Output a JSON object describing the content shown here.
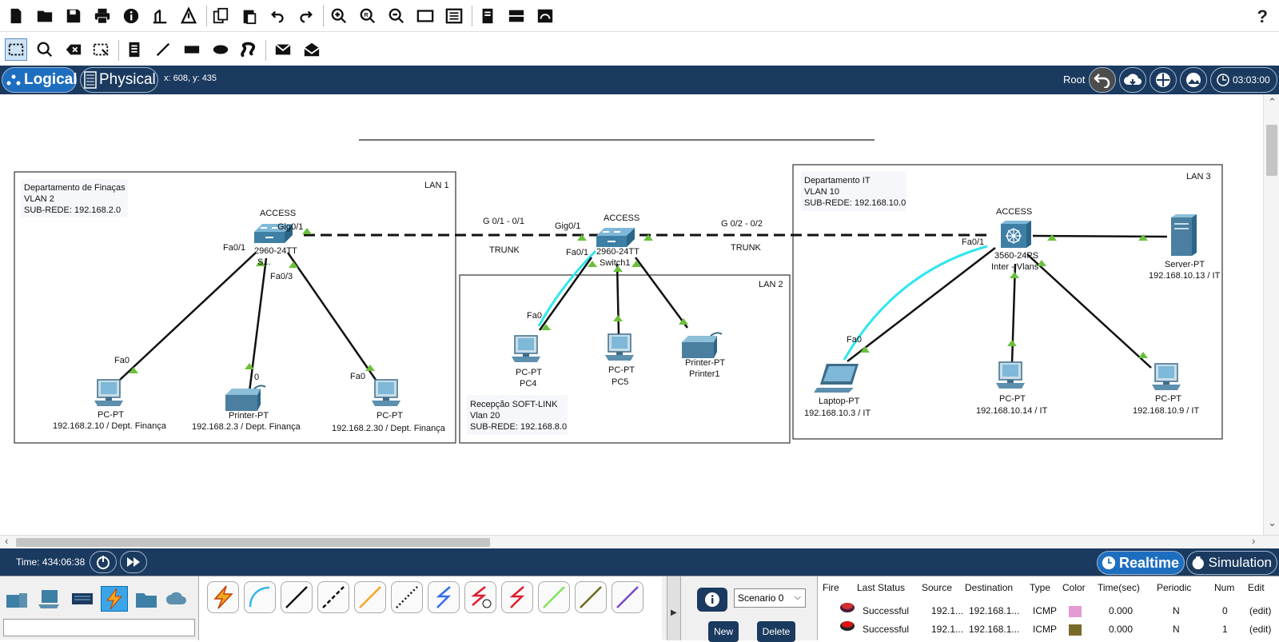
{
  "top_toolbar": {
    "icons": [
      "new-file-icon",
      "open-folder-icon",
      "save-icon",
      "print-icon",
      "info-icon",
      "activity-wizard-icon",
      "custom-pdu-icon",
      "copy-icon",
      "paste-icon",
      "undo-icon",
      "redo-icon",
      "zoom-in-icon",
      "zoom-reset-icon",
      "zoom-out-icon",
      "drawing-palette-icon",
      "custom-devices-icon",
      "notes-icon",
      "cluster-icon",
      "viewport-icon"
    ],
    "help": "?"
  },
  "edit_toolbar": {
    "icons": [
      "select-icon",
      "inspect-icon",
      "delete-icon",
      "resize-icon",
      "note-icon",
      "line-icon",
      "rectangle-icon",
      "ellipse-icon",
      "freeform-icon",
      "simple-pdu-icon",
      "complex-pdu-icon"
    ]
  },
  "navbar": {
    "logical_label": "Logical",
    "physical_label": "Physical",
    "coords": "x: 608, y: 435",
    "root_label": "Root",
    "clock": "03:03:00"
  },
  "topology": {
    "zones": {
      "lan1": {
        "tag": "LAN 1",
        "desc": [
          "Departamento de Finaças",
          "VLAN 2",
          "SUB-REDE: 192.168.2.0"
        ]
      },
      "lan2": {
        "tag": "LAN 2",
        "desc": [
          "Recepção SOFT-LINK",
          "Vlan 20",
          "SUB-REDE: 192.168.8.0"
        ]
      },
      "lan3": {
        "tag": "LAN 3",
        "desc": [
          "Departamento IT",
          "VLAN 10",
          "SUB-REDE: 192.168.10.0"
        ]
      }
    },
    "switch_left": {
      "role": "ACCESS",
      "model": "2960-24TT",
      "name": "S..."
    },
    "switch_mid": {
      "role": "ACCESS",
      "model": "2960-24TT",
      "name": "Switch1"
    },
    "switch_right": {
      "role": "ACCESS",
      "model": "3560-24PS",
      "name": "Inter - Vlans"
    },
    "trunk_left": {
      "ports": "G 0/1 - 0/1",
      "type": "TRUNK"
    },
    "trunk_right": {
      "ports": "G 0/2 - 0/2",
      "type": "TRUNK"
    },
    "ports": {
      "gig01_left": "Gig0/1",
      "gig01_mid": "Gig0/1",
      "fa01_left": "Fa0/1",
      "fa03_left": "Fa0/3",
      "fa01_mid": "Fa0/1",
      "fa01_right": "Fa0/1",
      "fa0_pc1": "Fa0",
      "p0_printer": "0",
      "fa0_pc2": "Fa0",
      "fa0_pc4": "Fa0",
      "fa0_laptop": "Fa0"
    },
    "devices": {
      "pc_a": {
        "type": "PC-PT",
        "label": "192.168.2.10 / Dept. Finança"
      },
      "printer_a": {
        "type": "Printer-PT",
        "label": "192.168.2.3 / Dept. Finança"
      },
      "pc_b": {
        "type": "PC-PT",
        "label": "192.168.2.30 / Dept. Finança"
      },
      "pc4": {
        "type": "PC-PT",
        "label": "PC4"
      },
      "pc5": {
        "type": "PC-PT",
        "label": "PC5"
      },
      "printer1": {
        "type": "Printer-PT",
        "label": "Printer1"
      },
      "laptop": {
        "type": "Laptop-PT",
        "label": "192.168.10.3 / IT"
      },
      "pc_it14": {
        "type": "PC-PT",
        "label": "192.168.10.14 / IT"
      },
      "pc_it9": {
        "type": "PC-PT",
        "label": "192.168.10.9 / IT"
      },
      "server": {
        "type": "Server-PT",
        "label": "192.168.10.13 / IT"
      }
    }
  },
  "timebar": {
    "time": "Time: 434:06:38",
    "realtime_label": "Realtime",
    "simulation_label": "Simulation"
  },
  "scenario": {
    "selected": "Scenario 0",
    "new_label": "New",
    "delete_label": "Delete"
  },
  "pdu_table": {
    "headers": [
      "Fire",
      "Last Status",
      "Source",
      "Destination",
      "Type",
      "Color",
      "Time(sec)",
      "Periodic",
      "Num",
      "Edit"
    ],
    "rows": [
      {
        "status": "Successful",
        "source": "192.1...",
        "destination": "192.168.1...",
        "type": "ICMP",
        "color": "#e59ad6",
        "time": "0.000",
        "periodic": "N",
        "num": "0",
        "edit": "(edit)"
      },
      {
        "status": "Successful",
        "source": "192.1...",
        "destination": "192.168.1...",
        "type": "ICMP",
        "color": "#7a6a2a",
        "time": "0.000",
        "periodic": "N",
        "num": "1",
        "edit": "(edit)"
      }
    ]
  },
  "colors": {
    "navy": "#1b3a5f",
    "accent": "#1e6ec0",
    "link_green": "#6bbf3c",
    "wireless_cyan": "#2ee6f0"
  }
}
